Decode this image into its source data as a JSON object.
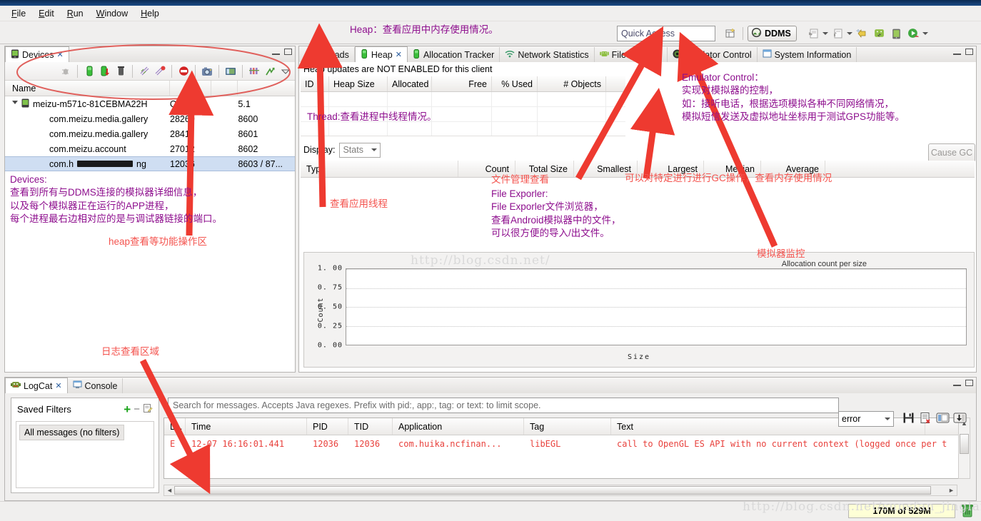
{
  "menu": {
    "items": [
      "File",
      "Edit",
      "Run",
      "Window",
      "Help"
    ]
  },
  "toolbar": {
    "quick_access_placeholder": "Quick Access",
    "perspective_label": "DDMS",
    "new_icon": "new-wizard-icon",
    "open_persp_icon": "open-perspective-icon",
    "import_icon": "import-icon",
    "export_icon": "export-icon",
    "next_edit_icon": "next-annotation-icon",
    "android_sdk_icon": "android-sdk-manager-icon",
    "avd_icon": "avd-manager-icon",
    "run_icon": "run-icon"
  },
  "devices": {
    "tab_label": "Devices",
    "tab_icon": "device-icon",
    "columns": [
      "Name",
      "",
      "",
      ""
    ],
    "toolbar_icons": [
      "debug-icon",
      "heap-update-icon",
      "heap-dump-icon",
      "gc-icon",
      "thread-update-icon",
      "method-profiling-icon",
      "stop-icon",
      "screen-capture-icon",
      "systrace-icon",
      "pixel-perfect-icon",
      "hierarchy-viewer-icon",
      "view-menu-icon"
    ],
    "rows": [
      {
        "name": "meizu-m571c-81CEBMA22H",
        "status": "Online",
        "blank": "",
        "port": "5.1",
        "type": "device",
        "selected": false,
        "redacted": false
      },
      {
        "name": "com.meizu.media.gallery",
        "status": "28269",
        "blank": "",
        "port": "8600",
        "type": "process",
        "selected": false,
        "redacted": false
      },
      {
        "name": "com.meizu.media.gallery",
        "status": "28411",
        "blank": "",
        "port": "8601",
        "type": "process",
        "selected": false,
        "redacted": false
      },
      {
        "name": "com.meizu.account",
        "status": "27012",
        "blank": "",
        "port": "8602",
        "type": "process",
        "selected": false,
        "redacted": false
      },
      {
        "name": "com.h████████ng",
        "status": "12036",
        "blank": "",
        "port": "8603 / 87...",
        "type": "process",
        "selected": true,
        "redacted": true
      }
    ]
  },
  "right_panel": {
    "tabs": [
      {
        "label": "Threads",
        "icon": "threads-icon",
        "active": false,
        "closable": false
      },
      {
        "label": "Heap",
        "icon": "heap-icon",
        "active": true,
        "closable": true
      },
      {
        "label": "Allocation Tracker",
        "icon": "allocation-tracker-icon",
        "active": false,
        "closable": false
      },
      {
        "label": "Network Statistics",
        "icon": "network-icon",
        "active": false,
        "closable": false
      },
      {
        "label": "File Explorer",
        "icon": "android-icon",
        "active": false,
        "closable": false
      },
      {
        "label": "Emulator Control",
        "icon": "emulator-icon",
        "active": false,
        "closable": false
      },
      {
        "label": "System Information",
        "icon": "system-info-icon",
        "active": false,
        "closable": false
      }
    ],
    "heap_message": "Heap updates are NOT ENABLED for this client",
    "heap_columns": [
      "ID",
      "Heap Size",
      "Allocated",
      "Free",
      "% Used",
      "# Objects"
    ],
    "display_label": "Display:",
    "display_value": "Stats",
    "cause_gc_label": "Cause GC",
    "stats_columns": [
      "Type",
      "Count",
      "Total Size",
      "Smallest",
      "Largest",
      "Median",
      "Average"
    ]
  },
  "chart_data": {
    "type": "bar",
    "title": "Allocation count per size",
    "xlabel": "Size",
    "ylabel": "Count",
    "categories": [],
    "values": [],
    "yticks": [
      "1. 00",
      "0. 75",
      "0. 50",
      "0. 25",
      "0. 00"
    ],
    "ylim": [
      0,
      1
    ],
    "grid": true,
    "legend": "none"
  },
  "logcat": {
    "tabs": [
      {
        "label": "LogCat",
        "icon": "logcat-icon",
        "active": true,
        "closable": true
      },
      {
        "label": "Console",
        "icon": "console-icon",
        "active": false,
        "closable": false
      }
    ],
    "saved_filters_label": "Saved Filters",
    "add_filter_icon": "plus-icon",
    "remove_filter_icon": "minus-icon",
    "edit_filter_icon": "edit-filter-icon",
    "filter_items": [
      "All messages (no filters)"
    ],
    "search_placeholder": "Search for messages. Accepts Java regexes. Prefix with pid:, app:, tag: or text: to limit scope.",
    "level_value": "error",
    "right_icons": [
      "save-log-icon",
      "clear-log-icon",
      "display-view-icon",
      "scroll-lock-icon"
    ],
    "columns": [
      "L...",
      "Time",
      "PID",
      "TID",
      "Application",
      "Tag",
      "Text"
    ],
    "rows": [
      {
        "level": "E",
        "time": "12-07 16:16:01.441",
        "pid": "12036",
        "tid": "12036",
        "application": "com.huika.ncfinan...",
        "tag": "libEGL",
        "text": "call to OpenGL ES API with no current context (logged once per thread)"
      }
    ]
  },
  "status_bar": {
    "heap_status": "170M of 529M",
    "trash_icon": "trash-icon"
  },
  "watermarks": [
    "http://blog.csdn.net/",
    "http://blog.csdn.net/sunsfan_jinglan"
  ],
  "annotations": {
    "heap_top": "Heap：查看应用中内存使用情况。",
    "thread": "Thread:查看进程中线程情况。",
    "emulator_control": "Emulator Control：\n实现对模拟器的控制，\n如：接听电话，根据选项模拟各种不同网络情况，\n模拟短信发送及虚拟地址坐标用于测试GPS功能等。",
    "devices": "Devices:\n查看到所有与DDMS连接的模拟器详细信息，\n以及每个模拟器正在运行的APP进程，\n每个进程最右边相对应的是与调试器链接的端口。",
    "heap_ops": "heap查看等功能操作区",
    "view_threads": "查看应用线程",
    "file_manager": "文件管理查看",
    "file_explorer": "File Exporler:\nFile Exporler文件浏览器，\n查看Android模拟器中的文件，\n可以很方便的导入/出文件。",
    "gc_op": "可以对特定进行进行GC操作，查看内存使用情况",
    "emulator_monitor": "模拟器监控",
    "log_area": "日志查看区域"
  }
}
